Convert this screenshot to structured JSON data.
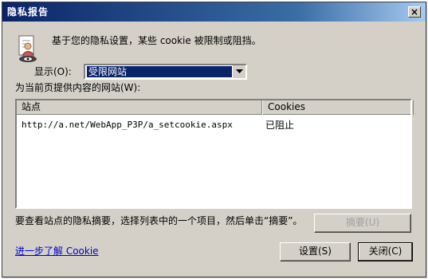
{
  "window": {
    "title": "隐私报告",
    "close_glyph": "×"
  },
  "message": "基于您的隐私设置，某些 cookie 被限制或阻挡。",
  "display": {
    "label": "显示(O):",
    "selected": "受限网站"
  },
  "sites_label": "为当前页提供内容的网站(W):",
  "table": {
    "headers": [
      "站点",
      "Cookies"
    ],
    "rows": [
      {
        "site": "http://a.net/WebApp_P3P/a_setcookie.aspx",
        "cookie": "已阻止"
      }
    ]
  },
  "summary_hint": "要查看站点的隐私摘要，选择列表中的一个项目，然后单击“摘要”。",
  "buttons": {
    "summary": "摘要(U)",
    "settings": "设置(S)",
    "close": "关闭(C)"
  },
  "learn_more": "进一步了解 Cookie",
  "icons": {
    "privacy": "privacy-report-icon",
    "dropdown": "chevron-down-icon",
    "close": "close-icon"
  },
  "colors": {
    "title_start": "#0a246a",
    "title_end": "#a6caf0",
    "selection": "#0a246a",
    "link": "#0000cc",
    "dialog_bg": "#d4d0c8"
  }
}
